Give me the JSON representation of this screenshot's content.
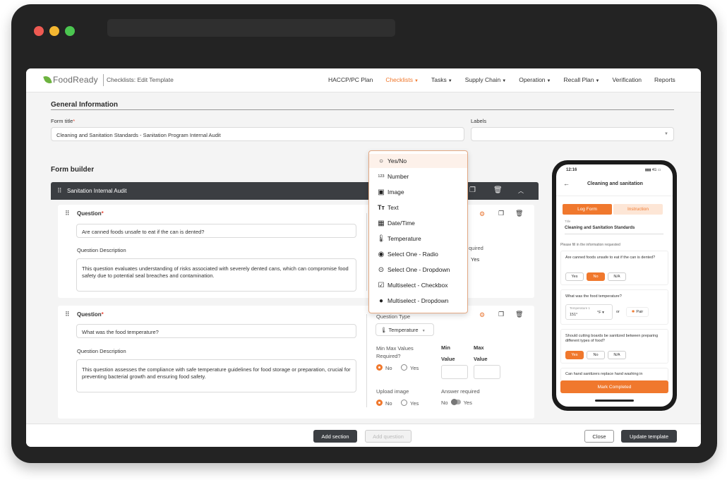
{
  "nav": {
    "logo": "FoodReady",
    "breadcrumb": "Checklists: Edit Template",
    "items": [
      {
        "label": "HACCP/PC Plan"
      },
      {
        "label": "Checklists",
        "active": true
      },
      {
        "label": "Tasks"
      },
      {
        "label": "Supply Chain"
      },
      {
        "label": "Operation"
      },
      {
        "label": "Recall Plan"
      },
      {
        "label": "Verification"
      },
      {
        "label": "Reports"
      }
    ]
  },
  "general": {
    "heading": "General Information",
    "form_title_label": "Form title",
    "form_title_value": "Cleaning and Sanitation Standards - Sanitation Program Internal Audit",
    "labels_label": "Labels"
  },
  "builder": {
    "heading": "Form builder",
    "section_name": "Sanitation Internal Audit",
    "question_label": "Question",
    "description_label": "Question Description",
    "q1": {
      "text": "Are canned foods unsafe to eat if the can is dented?",
      "description": "This question evaluates understanding of risks associated with severely dented cans, which can compromise food safety due to potential seal breaches and contamination.",
      "partial_label": "quired",
      "partial_value": "Yes"
    },
    "q2": {
      "text": "What was the food temperature?",
      "description": "This question assesses the compliance with safe temperature guidelines for food storage or preparation, crucial for preventing bacterial growth and ensuring food safety.",
      "type_label": "Question Type",
      "type_value": "Temperature",
      "minmax_label": "Min Max Values Required?",
      "min_label": "Min",
      "max_label": "Max",
      "value_label": "Value",
      "no": "No",
      "yes": "Yes",
      "upload_label": "Upload image",
      "answer_req_label": "Answer required"
    }
  },
  "dropdown": {
    "items": [
      {
        "label": "Yes/No",
        "icon": "circle-outline-icon",
        "glyph": "○",
        "selected": true
      },
      {
        "label": "Number",
        "icon": "number-icon",
        "glyph": "123"
      },
      {
        "label": "Image",
        "icon": "image-icon",
        "glyph": "▣"
      },
      {
        "label": "Text",
        "icon": "text-icon",
        "glyph": "Tт"
      },
      {
        "label": "Date/Time",
        "icon": "calendar-icon",
        "glyph": "▦"
      },
      {
        "label": "Temperature",
        "icon": "thermometer-icon",
        "glyph": "🌡"
      },
      {
        "label": "Select One - Radio",
        "icon": "radio-icon",
        "glyph": "◉"
      },
      {
        "label": "Select One - Dropdown",
        "icon": "dropdown-icon",
        "glyph": "⊙"
      },
      {
        "label": "Multiselect - Checkbox",
        "icon": "checkbox-icon",
        "glyph": "☑"
      },
      {
        "label": "Multiselect - Dropdown",
        "icon": "multiselect-dropdown-icon",
        "glyph": "●"
      }
    ]
  },
  "footer": {
    "add_section": "Add section",
    "add_question": "Add question",
    "close": "Close",
    "update": "Update template"
  },
  "phone": {
    "time": "12:16",
    "signal": "4G",
    "title": "Cleaning and sanitation",
    "tab_log": "Log Form",
    "tab_instruction": "Instruction",
    "title_label": "Title",
    "title_value": "Cleaning and Sanitation Standards",
    "fill_note": "Please fill in the information requested",
    "q1": "Are canned foods unsafe to eat if the can is dented?",
    "yes": "Yes",
    "no": "No",
    "na": "N/A",
    "q2": "What was the food temperature?",
    "temp_label": "Temperature 1",
    "temp_value": "151°",
    "unit": "°F",
    "or": "or",
    "pair": "Pair",
    "q3": "Should cutting boards be sanitized between preparing different types of food?",
    "q4": "Can hand sanitizers replace hand washing in",
    "mark_completed": "Mark Completed"
  },
  "colors": {
    "accent": "#f0782d",
    "dark": "#3b3e42",
    "brand_green": "#6db33f"
  }
}
